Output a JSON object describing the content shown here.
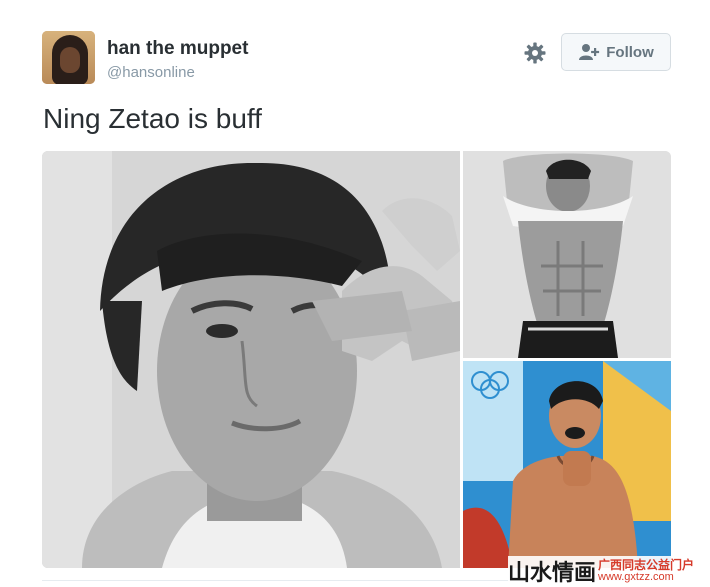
{
  "user": {
    "display_name": "han the muppet",
    "handle": "@hansonline"
  },
  "actions": {
    "follow_label": "Follow",
    "settings_icon": "gear-icon",
    "follow_icon": "add-user-icon"
  },
  "tweet": {
    "text": "Ning Zetao is buff"
  },
  "watermark": {
    "main": "山水情画",
    "side_text": "广西同志公益门户",
    "url": "www.gxtzz.com"
  },
  "colors": {
    "text": "#292f33",
    "muted": "#8899a6",
    "button_text": "#66757f",
    "watermark_red": "#d63a2a"
  }
}
